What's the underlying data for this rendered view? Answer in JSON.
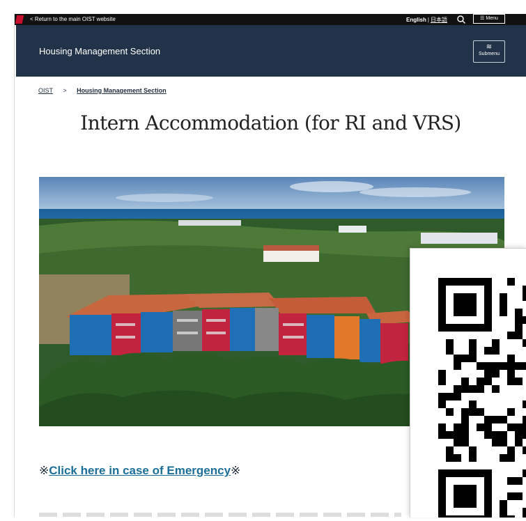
{
  "topbar": {
    "return_link": "< Return to the main OIST website",
    "lang_en": "English",
    "lang_sep": "|",
    "lang_jp": "日本語",
    "menu_label": "Menu"
  },
  "header": {
    "section_title": "Housing Management Section",
    "submenu_label": "Submenu"
  },
  "breadcrumb": {
    "root": "OIST",
    "separator": ">",
    "current": "Housing Management Section"
  },
  "page": {
    "title": "Intern Accommodation (for RI and VRS)"
  },
  "emergency": {
    "prefix": "※",
    "link_text": "Click here in case of Emergency",
    "suffix": "※"
  },
  "colors": {
    "header_bg": "#223349",
    "topbar_bg": "#111111",
    "link": "#1b6f99",
    "brand_red": "#c8102e"
  },
  "icons": {
    "search": "search-icon",
    "menu": "hamburger-icon",
    "submenu": "chevrons-down-icon",
    "logo": "oist-logo-icon",
    "qr": "qr-code-icon"
  }
}
